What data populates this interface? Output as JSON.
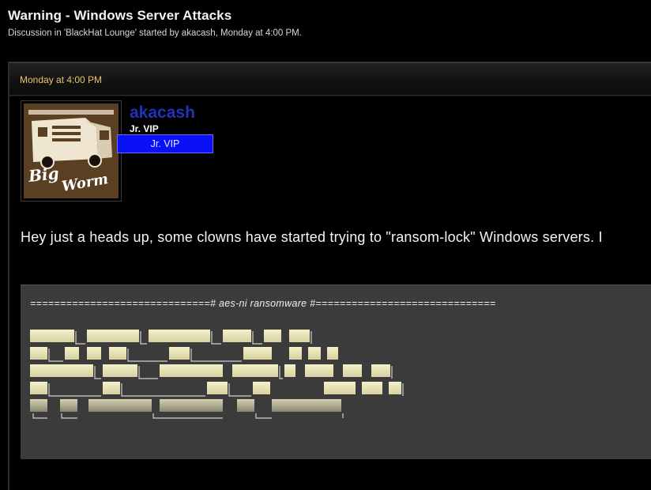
{
  "thread": {
    "title": "Warning - Windows Server Attacks",
    "meta": "Discussion in 'BlackHat Lounge' started by akacash, Monday at 4:00 PM."
  },
  "post": {
    "date": "Monday at 4:00 PM",
    "username": "akacash",
    "user_title": "Jr. VIP",
    "rank_badge": "Jr. VIP",
    "avatar": {
      "text_top": "Big",
      "text_bottom": "Worm"
    },
    "message": "Hey just a heads up, some clowns have started trying to \"ransom-lock\" Windows servers. I",
    "code": {
      "banner": "==============================# aes-ni ransomware #==============================",
      "ascii_icon": "ascii-banner-art"
    }
  },
  "colors": {
    "background": "#000000",
    "username": "#2133b8",
    "rank_badge": "#0a12f5",
    "date": "#e8c66a",
    "codebox": "#3b3b3b"
  }
}
